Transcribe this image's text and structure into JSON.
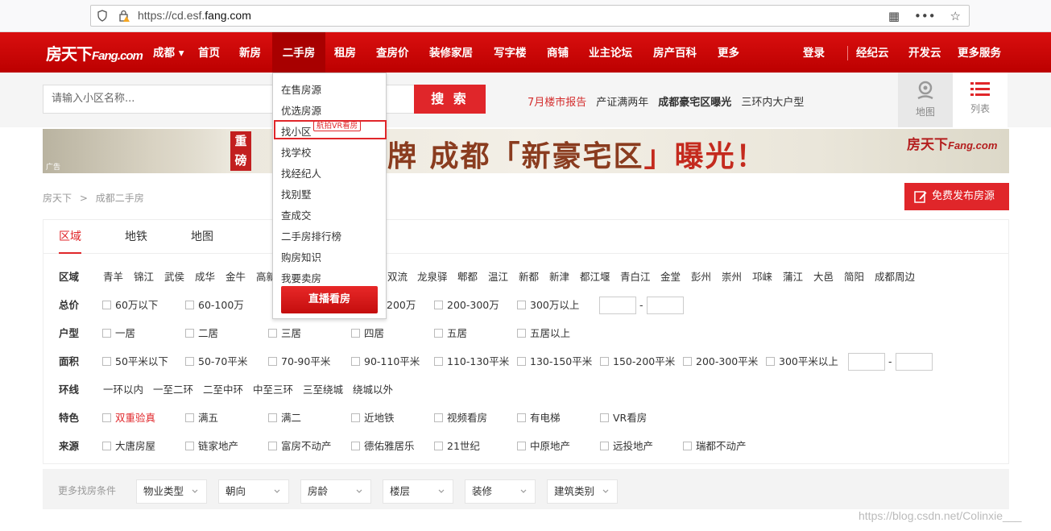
{
  "browser": {
    "url_prefix": "https://cd.esf.",
    "url_domain": "fang.com"
  },
  "nav": {
    "logo_cn": "房天下",
    "logo_en": "Fang.com",
    "city": "成都",
    "items": [
      "首页",
      "新房",
      "二手房",
      "租房",
      "查房价",
      "装修家居",
      "写字楼",
      "商铺",
      "业主论坛",
      "房产百科",
      "更多"
    ],
    "right": [
      "登录",
      "经纪云",
      "开发云",
      "更多服务"
    ]
  },
  "search": {
    "placeholder": "请输入小区名称...",
    "button": "搜 索",
    "hot_links": [
      "7月楼市报告",
      "产证满两年",
      "成都豪宅区曝光",
      "三环内大户型"
    ],
    "map_label": "地图",
    "list_label": "列表"
  },
  "banner": {
    "badge": "重磅",
    "text_a": "牌 成都「",
    "text_hl": "新豪宅区",
    "text_b": "」曝光！",
    "ad": "广告",
    "logo_cn": "房天下",
    "logo_en": "Fang.com"
  },
  "breadcrumb": [
    "房天下",
    ">",
    "成都二手房"
  ],
  "post_button": "免费发布房源",
  "tabs": [
    "区域",
    "地铁",
    "地图"
  ],
  "filters": {
    "district": {
      "label": "区域",
      "options": [
        "青羊",
        "锦江",
        "武侯",
        "成华",
        "金牛",
        "高新",
        "双流",
        "龙泉驿",
        "郫都",
        "温江",
        "新都",
        "新津",
        "都江堰",
        "青白江",
        "金堂",
        "彭州",
        "崇州",
        "邛崃",
        "蒲江",
        "大邑",
        "简阳",
        "成都周边"
      ]
    },
    "price": {
      "label": "总价",
      "options": [
        "60万以下",
        "60-100万",
        "200万",
        "200-300万",
        "300万以上"
      ]
    },
    "layout": {
      "label": "户型",
      "options": [
        "一居",
        "二居",
        "三居",
        "四居",
        "五居",
        "五居以上"
      ]
    },
    "area": {
      "label": "面积",
      "options": [
        "50平米以下",
        "50-70平米",
        "70-90平米",
        "90-110平米",
        "110-130平米",
        "130-150平米",
        "150-200平米",
        "200-300平米",
        "300平米以上"
      ]
    },
    "ring": {
      "label": "环线",
      "options": [
        "一环以内",
        "一至二环",
        "二至中环",
        "中至三环",
        "三至绕城",
        "绕城以外"
      ]
    },
    "feature": {
      "label": "特色",
      "options": [
        "双重验真",
        "满五",
        "满二",
        "近地铁",
        "视频看房",
        "有电梯",
        "VR看房"
      ]
    },
    "source": {
      "label": "来源",
      "options": [
        "大唐房屋",
        "链家地产",
        "富房不动产",
        "德佑雅居乐",
        "21世纪",
        "中原地产",
        "远投地产",
        "瑞都不动产"
      ]
    },
    "range_dash": "-"
  },
  "more": {
    "label": "更多找房条件",
    "selects": [
      "物业类型",
      "朝向",
      "房龄",
      "楼层",
      "装修",
      "建筑类别"
    ]
  },
  "dropdown": {
    "items": [
      "在售房源",
      "优选房源",
      "找小区",
      "找学校",
      "找经纪人",
      "找别墅",
      "查成交",
      "二手房排行榜",
      "购房知识",
      "我要卖房"
    ],
    "tag": "航拍VR看房",
    "live_button": "直播看房"
  },
  "watermark": "https://blog.csdn.net/Colinxie___",
  "colors": {
    "brand_red": "#c90000",
    "accent_red": "#e0262a"
  }
}
